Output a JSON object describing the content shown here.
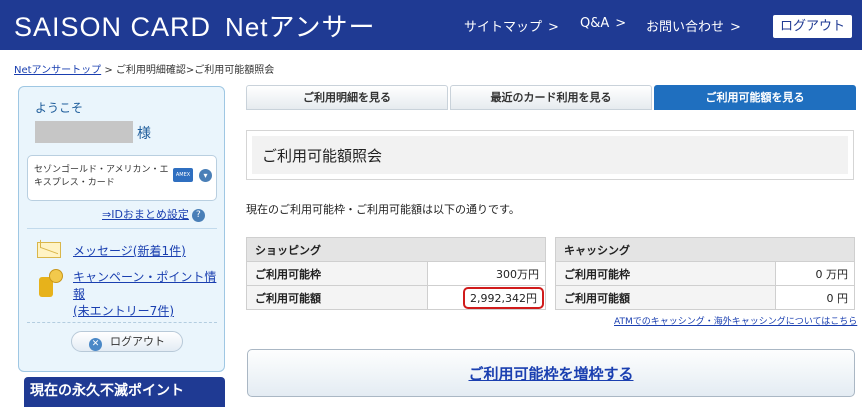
{
  "header": {
    "brand": "SAISON CARD",
    "service": "Netアンサー",
    "nav": [
      {
        "label": "サイトマップ",
        "chevron": ">"
      },
      {
        "label": "Q&A",
        "chevron": ">"
      },
      {
        "label": "お問い合わせ",
        "chevron": ">"
      }
    ],
    "logout_label": "ログアウト",
    "bg_color": "#1f3a93"
  },
  "breadcrumb": {
    "home": "Netアンサートップ",
    "sep1": " > ",
    "middle": "ご利用明細確認",
    "sep2": ">",
    "current": "ご利用可能額照会"
  },
  "sidebar": {
    "welcome": "ようこそ",
    "honorific": "様",
    "card_name": "セゾンゴールド・アメリカン・エキスプレス・カード",
    "card_logo": "AMEX",
    "card_dropdown_icon": "chevron-down-icon",
    "id_link": "⇒IDおまとめ設定",
    "help_icon": "?",
    "messages_link": "メッセージ(新着1件)",
    "campaign_link_line1": "キャンペーン・ポイント情報",
    "campaign_link_line2": "(未エントリー7件)",
    "logout_label": "ログアウト",
    "points_title": "現在の永久不滅ポイント"
  },
  "tabs": [
    {
      "label": "ご利用明細を見る",
      "active": false
    },
    {
      "label": "最近のカード利用を見る",
      "active": false
    },
    {
      "label": "ご利用可能額を見る",
      "active": true
    }
  ],
  "main": {
    "title": "ご利用可能額照会",
    "description": "現在のご利用可能枠・ご利用可能額は以下の通りです。",
    "shopping": {
      "section_title": "ショッピング",
      "limit_label": "ご利用可能枠",
      "limit_value": "300万円",
      "available_label": "ご利用可能額",
      "available_value": "2,992,342円"
    },
    "cashing": {
      "section_title": "キャッシング",
      "limit_label": "ご利用可能枠",
      "limit_value": "0 万円",
      "available_label": "ご利用可能額",
      "available_value": "0 円"
    },
    "atm_link": "ATMでのキャッシング・海外キャッシングについてはこちら",
    "increase_button": "ご利用可能枠を増枠する"
  },
  "colors": {
    "accent": "#1f6fbf",
    "link": "#1a3fb0",
    "highlight": "#d01b1b"
  }
}
